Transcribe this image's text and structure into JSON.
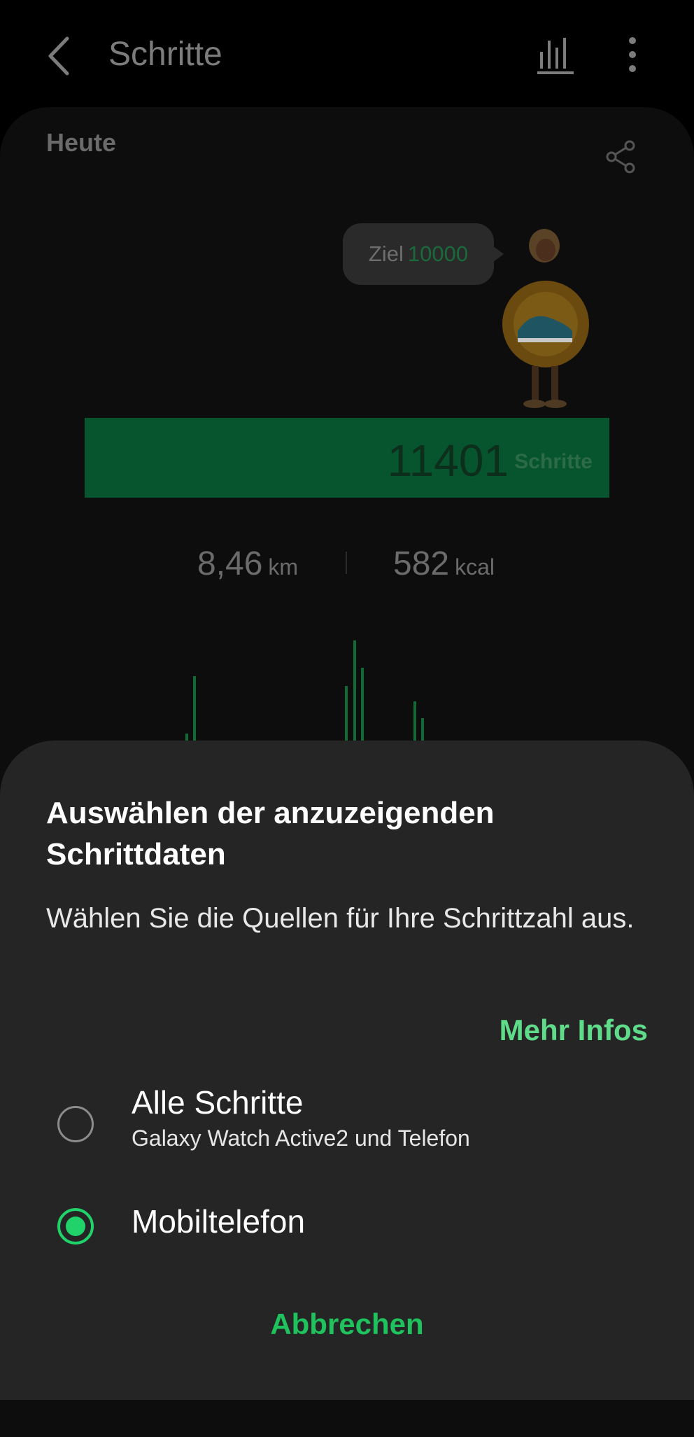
{
  "header": {
    "title": "Schritte"
  },
  "card": {
    "period": "Heute",
    "goal_label": "Ziel",
    "goal_value": "10000",
    "steps_count": "11401",
    "steps_unit": "Schritte",
    "distance_value": "8,46",
    "distance_unit": "km",
    "calories_value": "582",
    "calories_unit": "kcal"
  },
  "sheet": {
    "title": "Auswählen der anzuzeigenden Schrittdaten",
    "description": "Wählen Sie die Quellen für Ihre Schrittzahl aus.",
    "more_info": "Mehr Infos",
    "options": [
      {
        "label": "Alle Schritte",
        "sublabel": "Galaxy Watch Active2 und Telefon",
        "selected": false
      },
      {
        "label": "Mobiltelefon",
        "sublabel": "",
        "selected": true
      }
    ],
    "cancel": "Abbrechen"
  },
  "colors": {
    "accent_green": "#1fd36a",
    "link_green": "#5fdc8a",
    "sheet_bg": "#252525"
  },
  "icons": [
    "back-arrow-icon",
    "bar-chart-icon",
    "more-vertical-icon",
    "share-icon"
  ]
}
